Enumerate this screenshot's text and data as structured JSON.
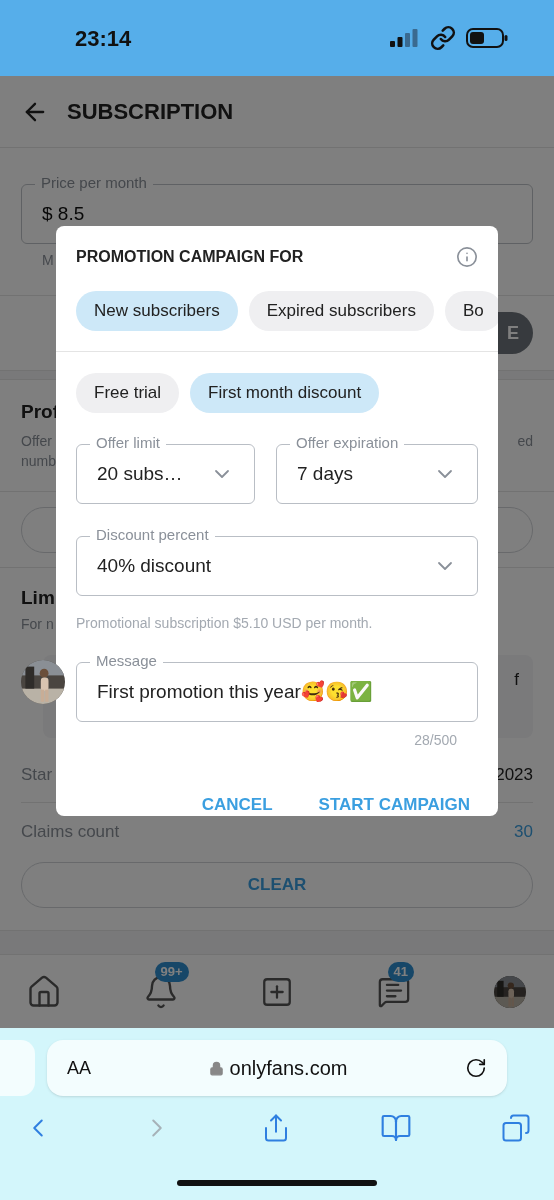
{
  "status_bar": {
    "time": "23:14"
  },
  "header": {
    "title": "SUBSCRIPTION"
  },
  "background": {
    "price_field": {
      "label": "Price per month",
      "value": "$ 8.5"
    },
    "price_note": "M",
    "save_button": "E",
    "promotion_section": {
      "title": "Prof",
      "line_1_start": "Offer",
      "line_1_end": "ed",
      "line_2": "numb"
    },
    "limited_section": {
      "title": "Lim",
      "subtitle": "For n",
      "card_text": "f",
      "start_label": "Star",
      "start_value": "2023",
      "claims_label": "Claims count",
      "claims_value": "30",
      "clear_button": "CLEAR"
    }
  },
  "bottom_nav": [
    {
      "kind": "home"
    },
    {
      "kind": "bell",
      "badge": "99+"
    },
    {
      "kind": "add"
    },
    {
      "kind": "chat",
      "badge": "41"
    },
    {
      "kind": "avatar"
    }
  ],
  "dialog": {
    "title": "PROMOTION CAMPAIGN FOR",
    "audience_chips": [
      {
        "label": "New subscribers",
        "selected": true
      },
      {
        "label": "Expired subscribers",
        "selected": false
      },
      {
        "label": "Bo",
        "selected": false
      }
    ],
    "offer_chips": [
      {
        "label": "Free trial",
        "selected": false
      },
      {
        "label": "First month discount",
        "selected": true
      }
    ],
    "offer_limit": {
      "label": "Offer limit",
      "value": "20 subs…"
    },
    "offer_expiration": {
      "label": "Offer expiration",
      "value": "7 days"
    },
    "discount_percent": {
      "label": "Discount percent",
      "value": "40% discount"
    },
    "summary": "Promotional subscription $5.10 USD per month.",
    "message": {
      "label": "Message",
      "value": "First promotion this year🥰😘✅",
      "counter": "28/500"
    },
    "buttons": [
      {
        "label": "CANCEL"
      },
      {
        "label": "START CAMPAIGN"
      }
    ]
  },
  "browser": {
    "text_size_button": "AA",
    "url": "onlyfans.com",
    "toolbar": [
      {
        "kind": "back",
        "disabled": false
      },
      {
        "kind": "forward",
        "disabled": true
      },
      {
        "kind": "share",
        "disabled": false
      },
      {
        "kind": "bookmarks",
        "disabled": false
      },
      {
        "kind": "tabs",
        "disabled": false
      }
    ]
  }
}
